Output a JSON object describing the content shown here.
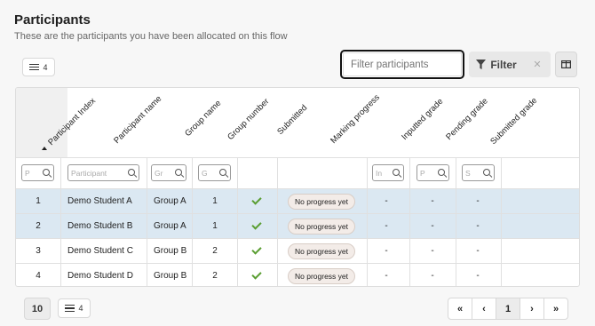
{
  "header": {
    "title": "Participants",
    "subtitle": "These are the participants you have been allocated on this flow"
  },
  "toolbar": {
    "columns_count": "4",
    "filter_placeholder": "Filter participants",
    "filter_label": "Filter",
    "clear_icon": "close-icon",
    "columns_icon": "columns-icon"
  },
  "table": {
    "columns": [
      "Participant Index",
      "Participant name",
      "Group name",
      "Group number",
      "Submitted",
      "Marking progress",
      "Inputted grade",
      "Pending grade",
      "Submitted grade"
    ],
    "filters": [
      "P",
      "Participant",
      "Gr",
      "G",
      "",
      "",
      "In",
      "P",
      "S"
    ],
    "rows": [
      {
        "index": "1",
        "name": "Demo Student A",
        "group": "Group A",
        "group_number": "1",
        "submitted": true,
        "progress": "No progress yet",
        "inputted": "-",
        "pending": "-",
        "grade": "-",
        "selected": true
      },
      {
        "index": "2",
        "name": "Demo Student B",
        "group": "Group A",
        "group_number": "1",
        "submitted": true,
        "progress": "No progress yet",
        "inputted": "-",
        "pending": "-",
        "grade": "-",
        "selected": true
      },
      {
        "index": "3",
        "name": "Demo Student C",
        "group": "Group B",
        "group_number": "2",
        "submitted": true,
        "progress": "No progress yet",
        "inputted": "-",
        "pending": "-",
        "grade": "-",
        "selected": false
      },
      {
        "index": "4",
        "name": "Demo Student D",
        "group": "Group B",
        "group_number": "2",
        "submitted": true,
        "progress": "No progress yet",
        "inputted": "-",
        "pending": "-",
        "grade": "-",
        "selected": false
      }
    ]
  },
  "footer": {
    "page_size": "10",
    "columns_count": "4",
    "pagination": {
      "first": "«",
      "prev": "‹",
      "current": "1",
      "next": "›",
      "last": "»"
    }
  }
}
